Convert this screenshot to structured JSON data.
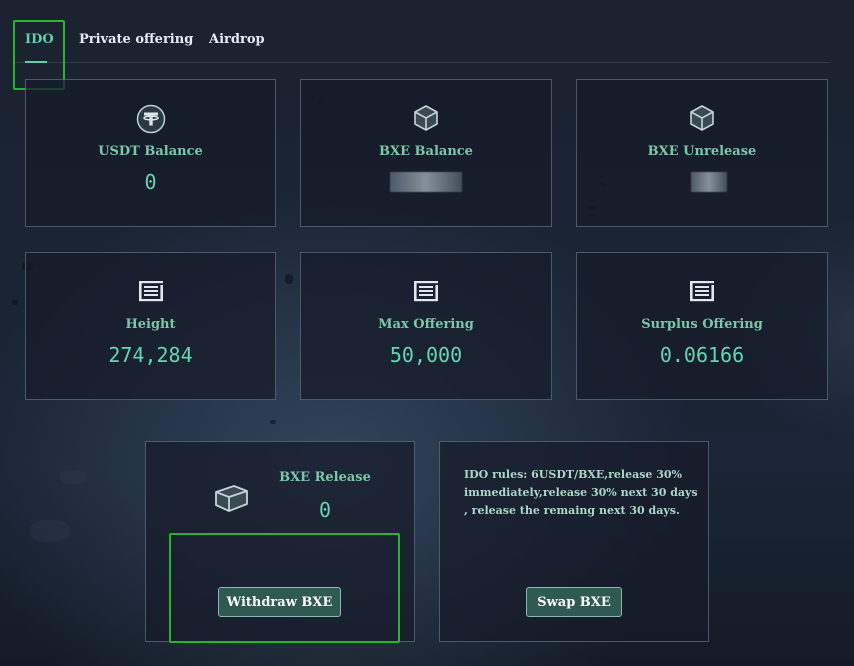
{
  "tabs": [
    {
      "label": "IDO",
      "active": true
    },
    {
      "label": "Private offering",
      "active": false
    },
    {
      "label": "Airdrop",
      "active": false
    }
  ],
  "cards": {
    "usdt_balance": {
      "label": "USDT Balance",
      "value": "0",
      "icon": "usdt-icon"
    },
    "bxe_balance": {
      "label": "BXE Balance",
      "value": "",
      "icon": "cube-icon"
    },
    "bxe_unrelease": {
      "label": "BXE Unrelease",
      "value": "",
      "icon": "cube-icon"
    },
    "height": {
      "label": "Height",
      "value": "274,284",
      "icon": "coin-logo-icon"
    },
    "max_offering": {
      "label": "Max Offering",
      "value": "50,000",
      "icon": "coin-logo-icon"
    },
    "surplus_offering": {
      "label": "Surplus Offering",
      "value": "0.06166",
      "icon": "coin-logo-icon"
    }
  },
  "release": {
    "label": "BXE Release",
    "value": "0",
    "button_label": "Withdraw BXE"
  },
  "rules": {
    "text": "IDO rules: 6USDT/BXE,release 30% immediately,release 30% next 30 days , release the remaing next 30 days.",
    "button_label": "Swap BXE"
  },
  "colors": {
    "accent": "#5fd0a8",
    "label": "#79c9a8",
    "button_bg": "#2e5a52",
    "highlight": "#27b52b"
  }
}
